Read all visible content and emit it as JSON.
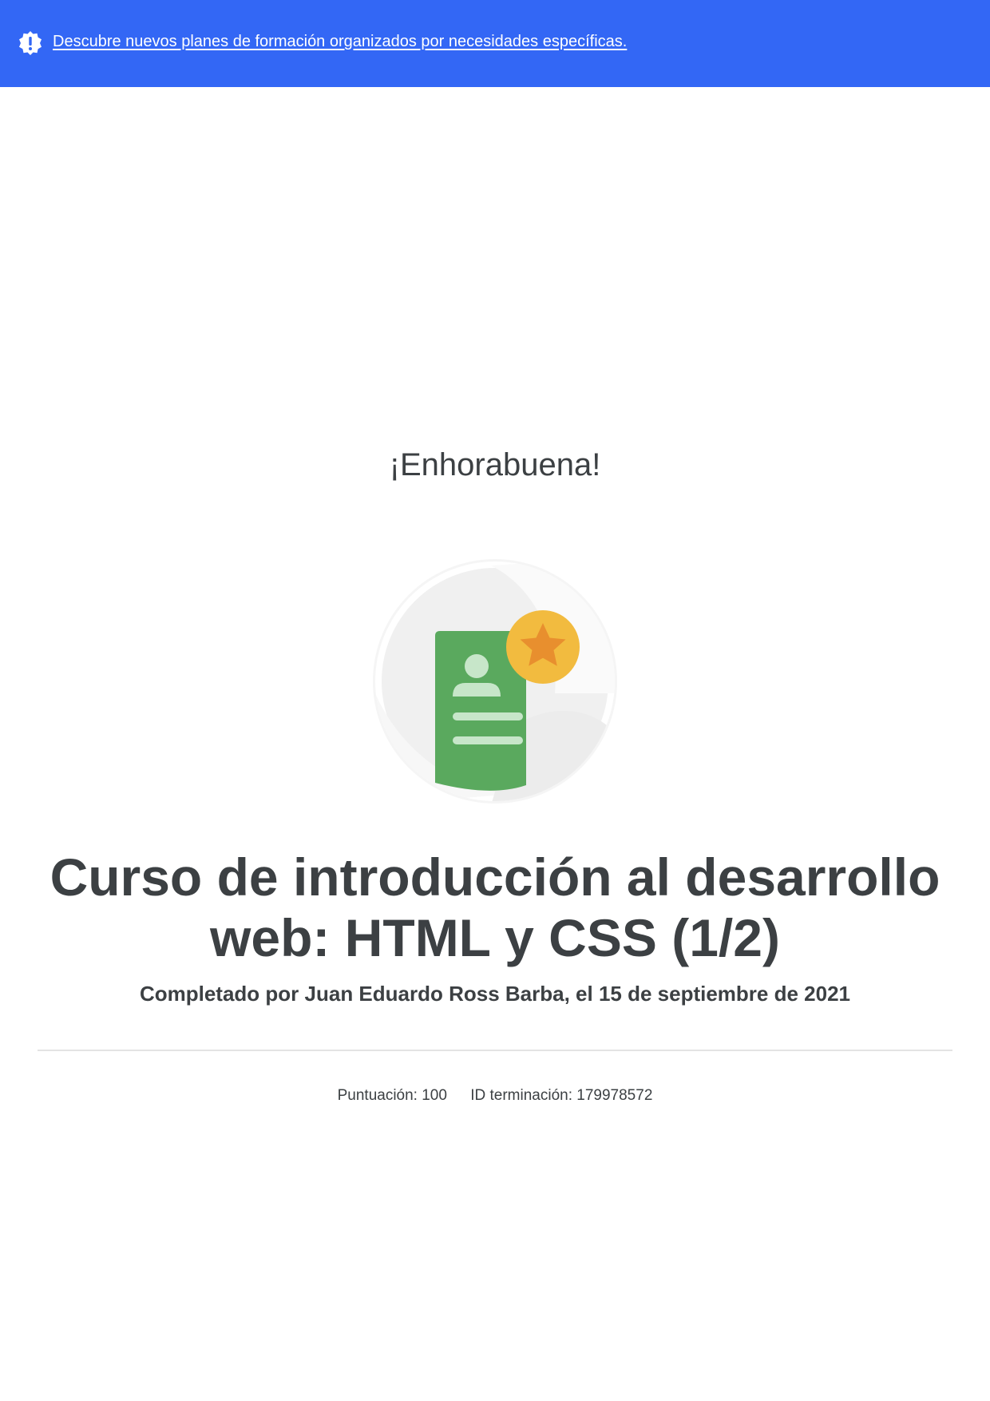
{
  "banner": {
    "link_text": "Descubre nuevos planes de formación organizados por necesidades específicas.",
    "icon": "alert-badge-icon",
    "background_color": "#3367f5"
  },
  "certificate": {
    "congrats": "¡Enhorabuena!",
    "badge_icon": "certificate-star-icon",
    "course_title": "Curso de introducción al desarrollo web: HTML y CSS (1/2)",
    "completed_by": "Completado por Juan Eduardo Ross Barba, el 15 de septiembre de 2021",
    "score": "Puntuación: 100",
    "completion_id": "ID terminación: 179978572"
  },
  "colors": {
    "badge_green": "#5aa95e",
    "star_yellow": "#f2bb3f",
    "star_orange": "#e88f2e"
  }
}
